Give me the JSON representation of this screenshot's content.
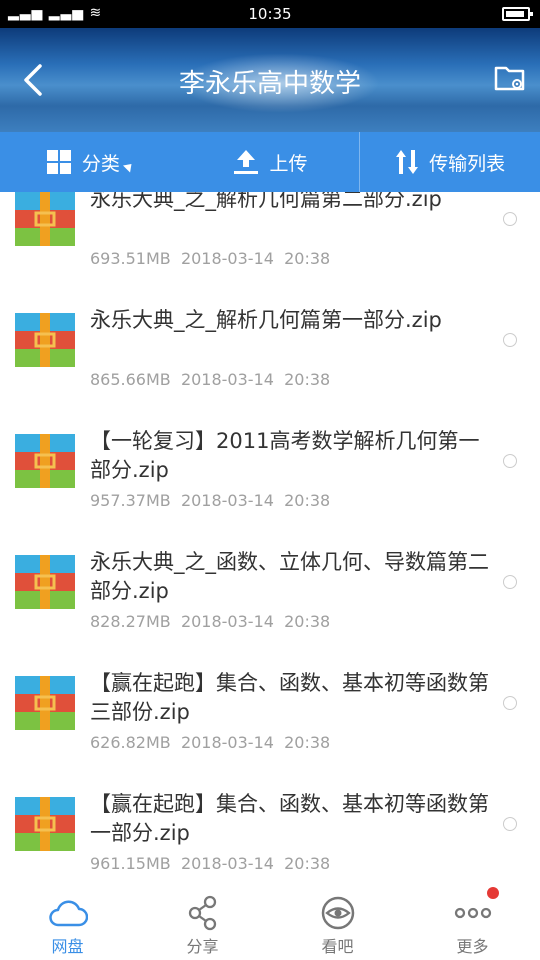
{
  "status": {
    "signal": "⁝ıll ıll",
    "time": "10:35"
  },
  "header": {
    "title": "李永乐高中数学",
    "back_icon": "back-arrow-icon",
    "folder_icon": "folder-settings-icon"
  },
  "toolbar": {
    "category_label": "分类",
    "upload_label": "上传",
    "transfer_label": "传输列表"
  },
  "files": [
    {
      "name": "永乐大典_之_解析几何篇第二部分.zip",
      "size": "693.51MB",
      "date": "2018-03-14",
      "time": "20:38"
    },
    {
      "name": "永乐大典_之_解析几何篇第一部分.zip",
      "size": "865.66MB",
      "date": "2018-03-14",
      "time": "20:38"
    },
    {
      "name": "【一轮复习】2011高考数学解析几何第一部分.zip",
      "size": "957.37MB",
      "date": "2018-03-14",
      "time": "20:38"
    },
    {
      "name": "永乐大典_之_函数、立体几何、导数篇第二部分.zip",
      "size": "828.27MB",
      "date": "2018-03-14",
      "time": "20:38"
    },
    {
      "name": "【赢在起跑】集合、函数、基本初等函数第三部份.zip",
      "size": "626.82MB",
      "date": "2018-03-14",
      "time": "20:38"
    },
    {
      "name": "【赢在起跑】集合、函数、基本初等函数第一部分.zip",
      "size": "961.15MB",
      "date": "2018-03-14",
      "time": "20:38"
    }
  ],
  "nav": {
    "disk_label": "网盘",
    "share_label": "分享",
    "watch_label": "看吧",
    "more_label": "更多"
  },
  "colors": {
    "accent": "#3a8fe6",
    "badge": "#e53935"
  }
}
